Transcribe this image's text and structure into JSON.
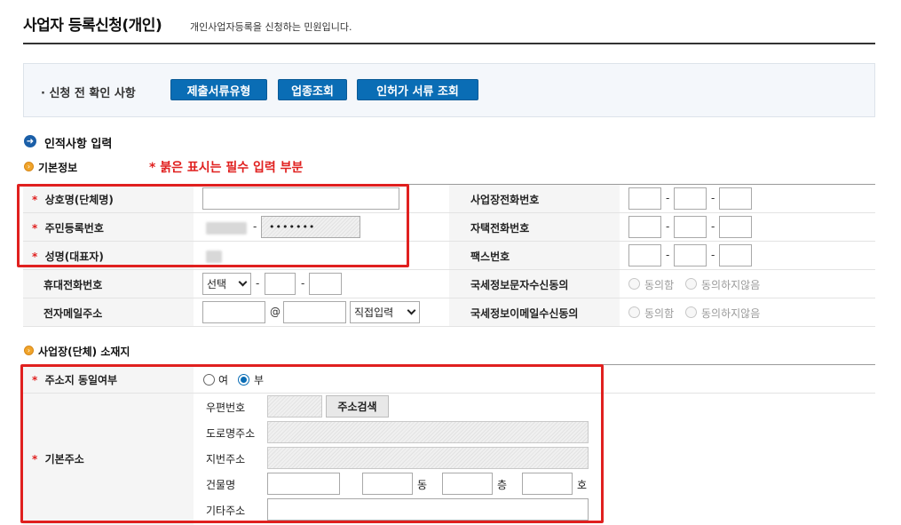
{
  "header": {
    "title": "사업자 등록신청(개인)",
    "subtitle": "개인사업자등록을 신청하는 민원입니다."
  },
  "prechecks": {
    "label": "· 신청 전 확인 사항",
    "buttons": [
      "제출서류유형",
      "업종조회",
      "인허가 서류 조회"
    ]
  },
  "section_personal": {
    "title": "인적사항 입력",
    "basic_title": "기본정보",
    "required_note": "* 붉은 표시는 필수 입력 부분",
    "star": "*",
    "fields": {
      "company_name": "상호명(단체명)",
      "rrn": "주민등록번호",
      "rep_name": "성명(대표자)",
      "mobile": "휴대전화번호",
      "email": "전자메일주소",
      "biz_phone": "사업장전화번호",
      "home_phone": "자택전화번호",
      "fax": "팩스번호",
      "sms_consent": "국세정보문자수신동의",
      "email_consent": "국세정보이메일수신동의"
    },
    "rrn_masked": "•••••••",
    "mobile_select": "선택",
    "email_at": "@",
    "email_select": "직접입력",
    "dash": "-",
    "consent_agree": "동의함",
    "consent_disagree": "동의하지않음"
  },
  "section_address": {
    "title": "사업장(단체) 소재지",
    "star": "*",
    "same_addr_label": "주소지 동일여부",
    "opt_yes": "여",
    "opt_no": "부",
    "base_addr_label": "기본주소",
    "postal": "우편번호",
    "search_btn": "주소검색",
    "road": "도로명주소",
    "lot": "지번주소",
    "building": "건물명",
    "dong": "동",
    "floor": "층",
    "ho": "호",
    "etc": "기타주소"
  }
}
